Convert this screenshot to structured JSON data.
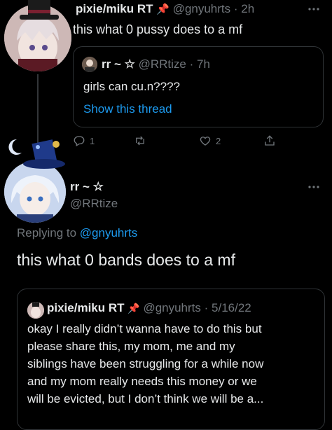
{
  "tweet1": {
    "display_name": "pixie/miku RT",
    "pin_emoji": "📌",
    "handle": "@gnyuhrts",
    "sep": "·",
    "time": "2h",
    "text": "this what 0 pussy does to a mf",
    "quote": {
      "display_name": "rr ~ ☆",
      "handle": "@RRtize",
      "sep": "·",
      "time": "7h",
      "text": "girls can cu.n????",
      "show_thread": "Show this thread"
    },
    "actions": {
      "reply_count": "1",
      "retweet_count": "",
      "like_count": "2"
    }
  },
  "tweet2": {
    "display_name": "rr ~ ☆",
    "handle": "@RRtize",
    "replying_prefix": "Replying to ",
    "replying_handle": "@gnyuhrts",
    "text": "this what 0 bands does to a mf",
    "quote": {
      "display_name": "pixie/miku RT",
      "pin_emoji": "📌",
      "handle": "@gnyuhrts",
      "sep": "·",
      "date": "5/16/22",
      "text_lines": [
        "okay I really didn’t wanna have to do this but",
        "please share this, my mom, me and my",
        "siblings have been struggling for a while now",
        "and my mom really needs this money or we",
        "will be evicted, but I don’t think we will be a..."
      ]
    }
  },
  "more_icon": "more-horizontal-icon",
  "colors": {
    "bg": "#000000",
    "text": "#e7e9ea",
    "muted": "#71767b",
    "link": "#1d9bf0",
    "border": "#2f3336"
  }
}
